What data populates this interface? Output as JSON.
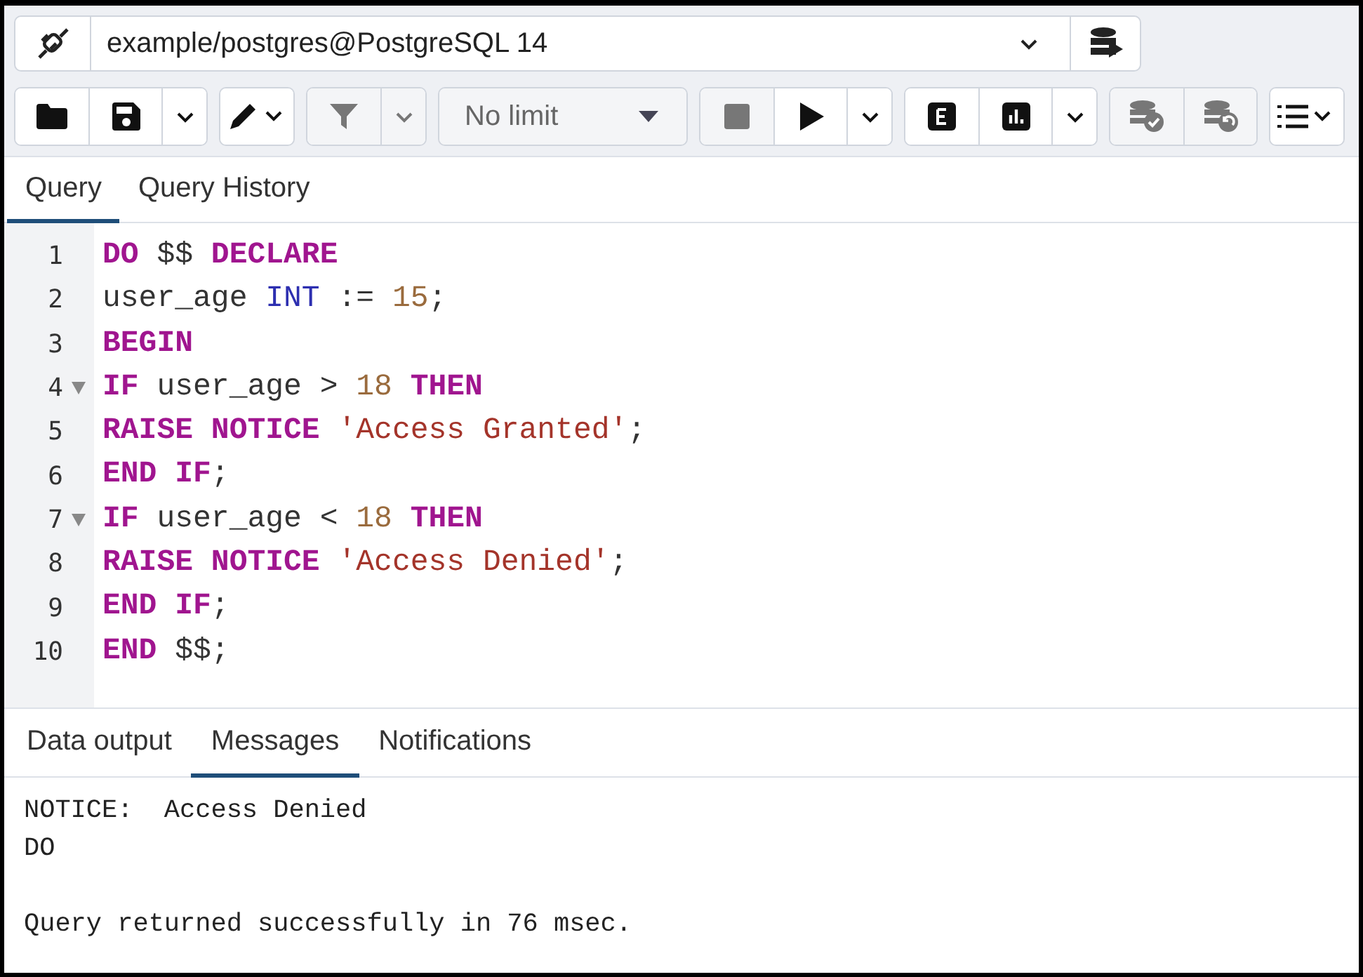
{
  "connection": {
    "label": "example/postgres@PostgreSQL 14"
  },
  "toolbar": [
    [
      {
        "kind": "folder",
        "disabled": false
      },
      {
        "kind": "save",
        "disabled": false
      },
      {
        "kind": "caret",
        "disabled": false
      }
    ],
    [
      {
        "kind": "pen",
        "disabled": false
      }
    ],
    [
      {
        "kind": "filter",
        "disabled": true
      },
      {
        "kind": "caret",
        "disabled": true
      }
    ],
    [
      {
        "kind": "limit",
        "label": "No limit",
        "disabled": true
      }
    ],
    [
      {
        "kind": "stop",
        "disabled": true
      },
      {
        "kind": "play",
        "disabled": false
      },
      {
        "kind": "caret",
        "disabled": false
      }
    ],
    [
      {
        "kind": "explain",
        "disabled": false
      },
      {
        "kind": "analyze",
        "disabled": false
      },
      {
        "kind": "caret",
        "disabled": false
      }
    ],
    [
      {
        "kind": "commit",
        "disabled": true
      },
      {
        "kind": "rollback",
        "disabled": true
      }
    ],
    [
      {
        "kind": "macros",
        "disabled": false
      }
    ]
  ],
  "tabs": [
    {
      "label": "Query",
      "selected": true
    },
    {
      "label": "Query History",
      "selected": false
    }
  ],
  "editor": {
    "lines": [
      {
        "number": "1",
        "foldable": false,
        "tokens": [
          {
            "kind": "keyword",
            "text": "DO"
          },
          {
            "kind": "plain",
            "text": " $$ "
          },
          {
            "kind": "keyword",
            "text": "DECLARE"
          }
        ]
      },
      {
        "number": "2",
        "foldable": false,
        "tokens": [
          {
            "kind": "plain",
            "text": "user_age "
          },
          {
            "kind": "type",
            "text": "INT"
          },
          {
            "kind": "plain",
            "text": " := "
          },
          {
            "kind": "number",
            "text": "15"
          },
          {
            "kind": "plain",
            "text": ";"
          }
        ]
      },
      {
        "number": "3",
        "foldable": false,
        "tokens": [
          {
            "kind": "keyword",
            "text": "BEGIN"
          }
        ]
      },
      {
        "number": "4",
        "foldable": true,
        "tokens": [
          {
            "kind": "keyword",
            "text": "IF"
          },
          {
            "kind": "plain",
            "text": " user_age > "
          },
          {
            "kind": "number",
            "text": "18"
          },
          {
            "kind": "keyword",
            "text": " THEN"
          }
        ]
      },
      {
        "number": "5",
        "foldable": false,
        "tokens": [
          {
            "kind": "keyword",
            "text": "RAISE NOTICE "
          },
          {
            "kind": "string",
            "text": "'Access Granted'"
          },
          {
            "kind": "plain",
            "text": ";"
          }
        ]
      },
      {
        "number": "6",
        "foldable": false,
        "tokens": [
          {
            "kind": "keyword",
            "text": "END IF"
          },
          {
            "kind": "plain",
            "text": ";"
          }
        ]
      },
      {
        "number": "7",
        "foldable": true,
        "tokens": [
          {
            "kind": "keyword",
            "text": "IF"
          },
          {
            "kind": "plain",
            "text": " user_age < "
          },
          {
            "kind": "number",
            "text": "18"
          },
          {
            "kind": "keyword",
            "text": " THEN"
          }
        ]
      },
      {
        "number": "8",
        "foldable": false,
        "tokens": [
          {
            "kind": "keyword",
            "text": "RAISE NOTICE "
          },
          {
            "kind": "string",
            "text": "'Access Denied'"
          },
          {
            "kind": "plain",
            "text": ";"
          }
        ]
      },
      {
        "number": "9",
        "foldable": false,
        "tokens": [
          {
            "kind": "keyword",
            "text": "END IF"
          },
          {
            "kind": "plain",
            "text": ";"
          }
        ]
      },
      {
        "number": "10",
        "foldable": false,
        "tokens": [
          {
            "kind": "keyword",
            "text": "END"
          },
          {
            "kind": "plain",
            "text": " $$;"
          }
        ]
      }
    ]
  },
  "output_tabs": [
    {
      "label": "Data output",
      "selected": false
    },
    {
      "label": "Messages",
      "selected": true
    },
    {
      "label": "Notifications",
      "selected": false
    }
  ],
  "messages": [
    [
      "NOTICE:  Access Denied",
      "DO"
    ],
    [
      "Query returned successfully in 76 msec."
    ]
  ]
}
